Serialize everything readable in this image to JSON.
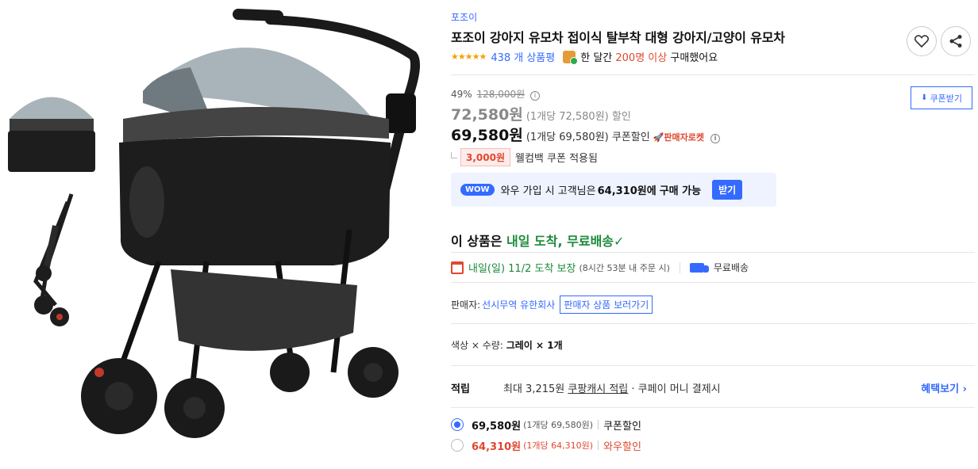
{
  "product": {
    "brand": "포조이",
    "title": "포조이 강아지 유모차 접이식 탈부착 대형 강아지/고양이 유모차",
    "stars": "★★★★★",
    "review_count": "438 개 상품평",
    "buy_prefix": "한 달간",
    "buy_highlight": "200명 이상",
    "buy_suffix": "구매했어요"
  },
  "pricing": {
    "discount_rate": "49%",
    "original_price": "128,000원",
    "coupon_download": "쿠폰받기",
    "sale_price": "72,580원",
    "sale_sub": "(1개당 72,580원) 할인",
    "coupon_price": "69,580원",
    "coupon_sub": "(1개당 69,580원) 쿠폰할인",
    "rocket_label": "판매자로켓",
    "welcome_amount": "3,000원",
    "welcome_text": "웰컴백 쿠폰 적용됨",
    "wow_badge": "WOW",
    "wow_prefix": "와우 가입 시 고객님은",
    "wow_price": "64,310원에",
    "wow_suffix": "구매 가능",
    "wow_button": "받기"
  },
  "delivery": {
    "arrival_prefix": "이 상품은",
    "arrival_highlight": "내일 도착, 무료배송",
    "arrival_check": "✓",
    "date": "내일(일) 11/2 도착 보장",
    "note": "(8시간 53분 내 주문 시)",
    "free_shipping": "무료배송"
  },
  "seller": {
    "label": "판매자:",
    "name": "선시무역 유한회사",
    "button": "판매자 상품 보러가기"
  },
  "option": {
    "label": "색상 × 수량:",
    "value": "그레이 × 1개"
  },
  "points": {
    "label": "적립",
    "prefix": "최대 3,215원",
    "link": "쿠팡캐시 적립",
    "suffix": "· 쿠페이 머니 결제시",
    "benefit_link": "혜택보기 ›"
  },
  "price_options": [
    {
      "price": "69,580원",
      "sub": "(1개당 69,580원)",
      "label": "쿠폰할인",
      "selected": true
    },
    {
      "price": "64,310원",
      "sub": "(1개당 64,310원)",
      "label": "와우할인",
      "selected": false
    }
  ],
  "colors": {
    "accent": "#346aff",
    "green": "#1c8a3b",
    "red": "#e0482f",
    "canopy": "#a9b4ba"
  }
}
